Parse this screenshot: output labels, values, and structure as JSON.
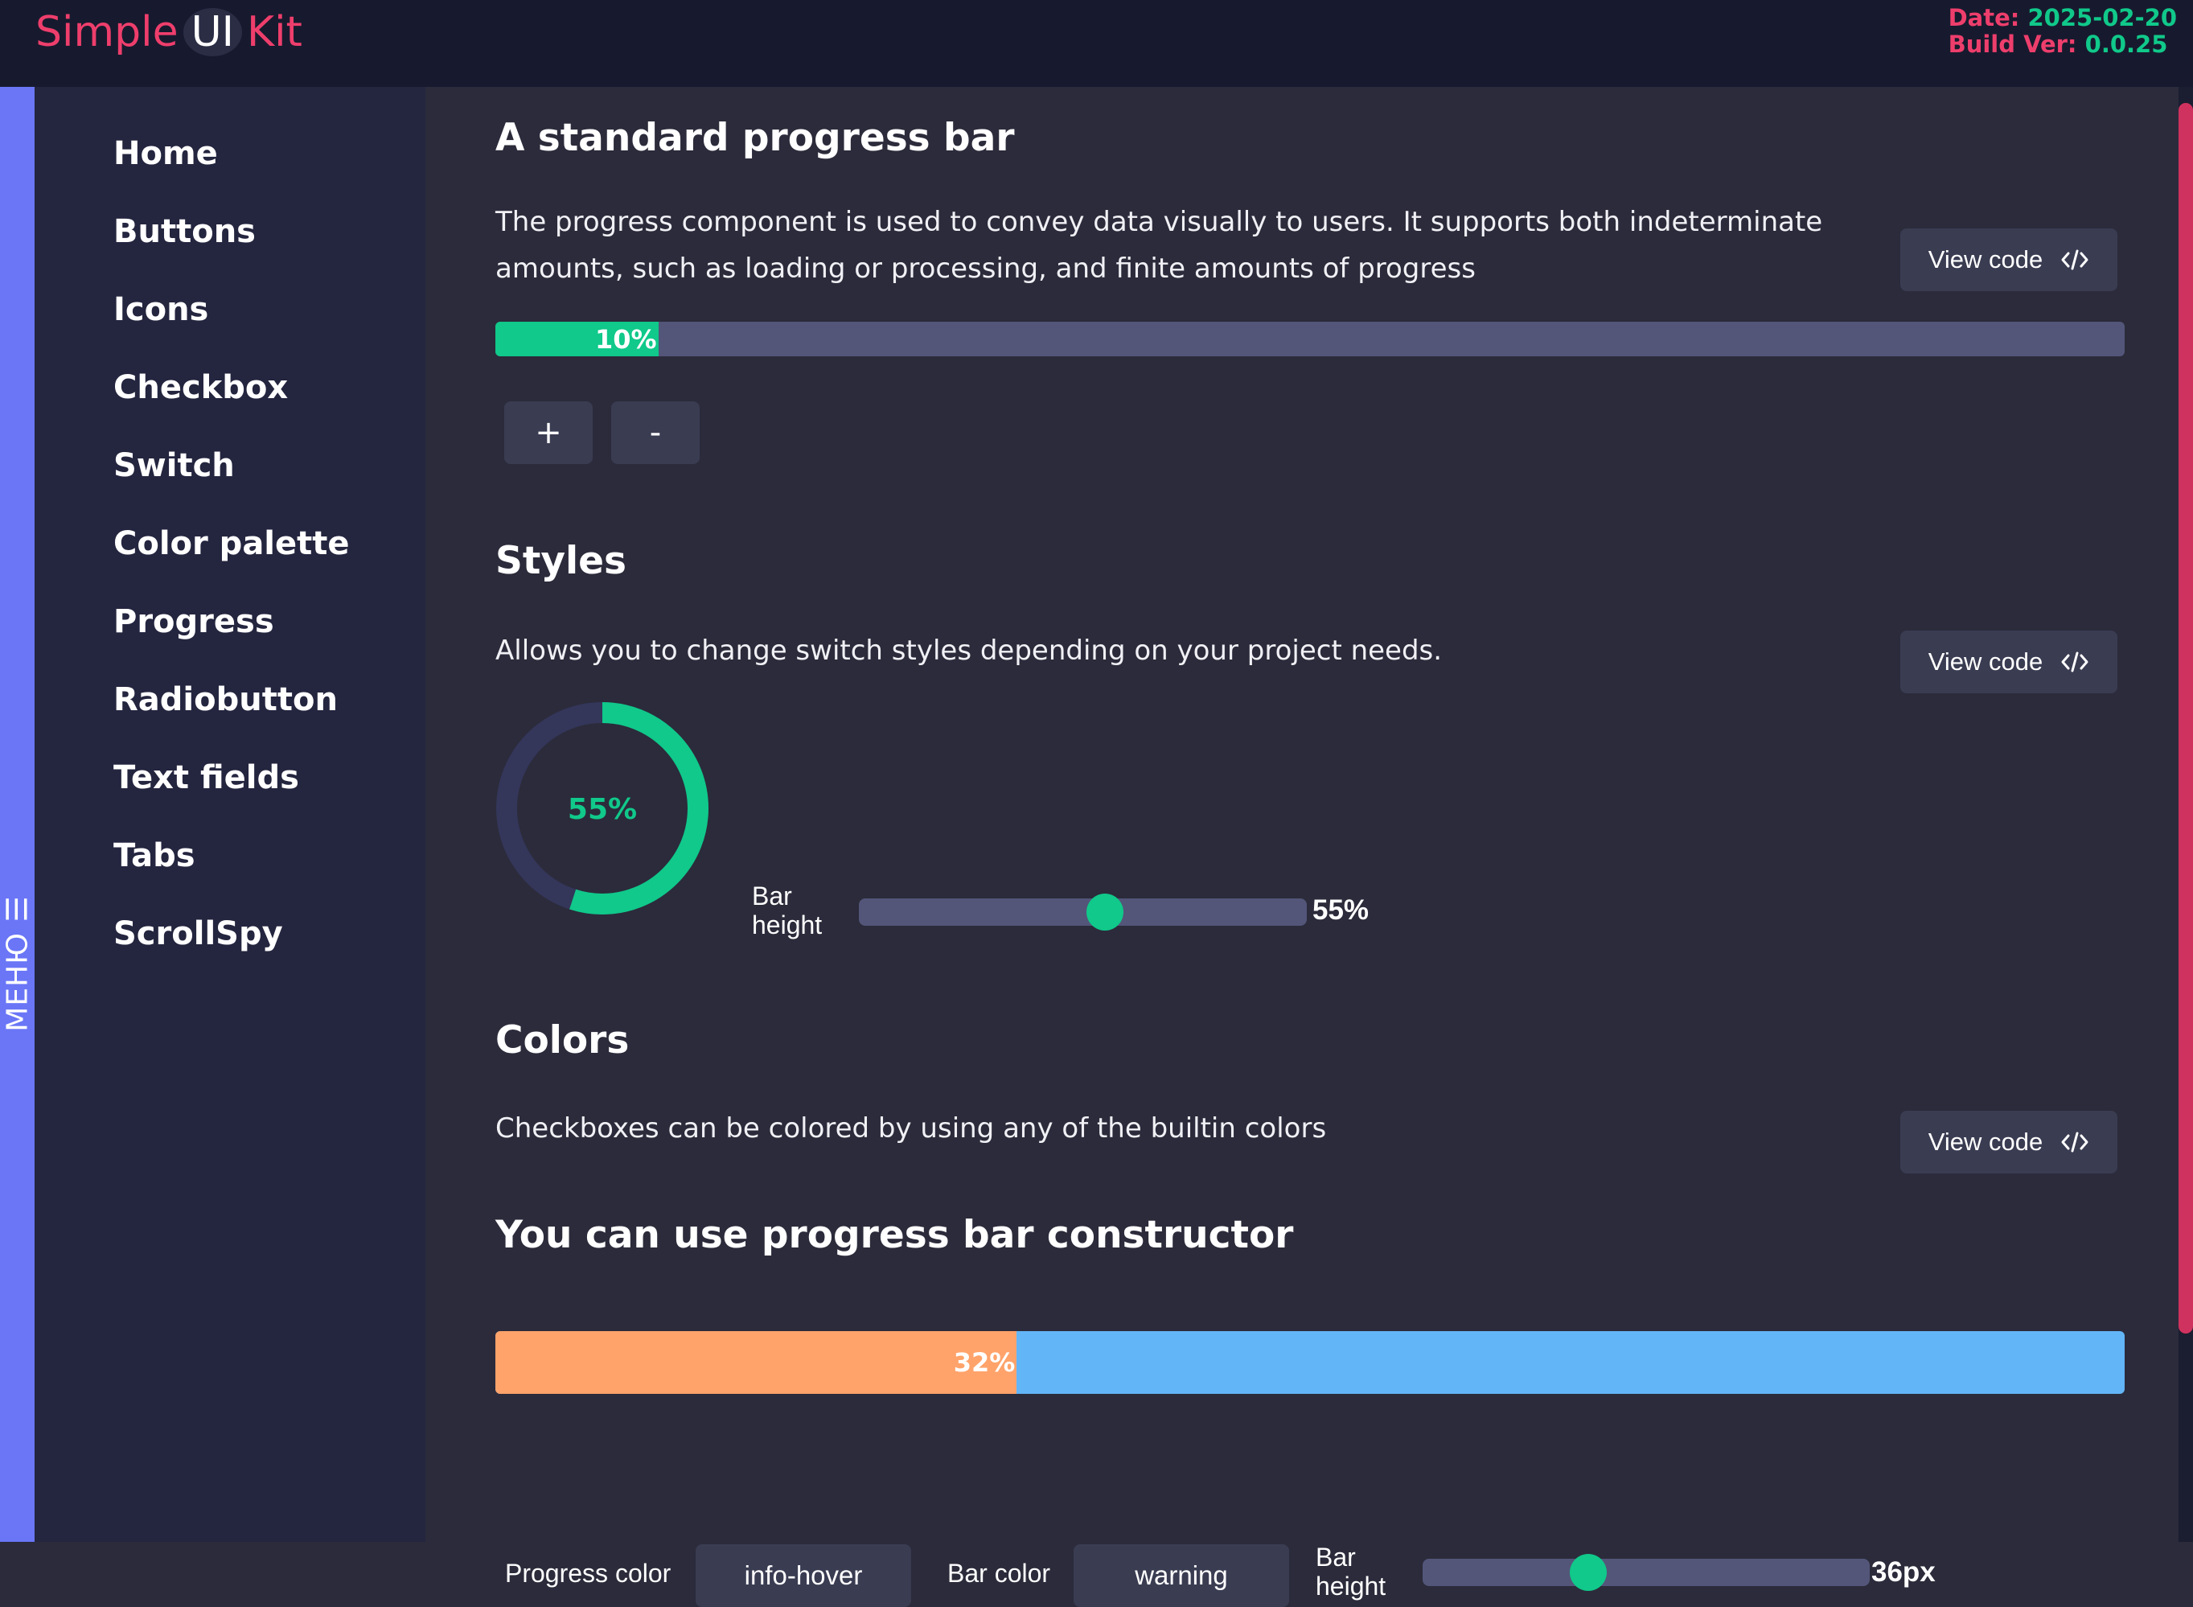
{
  "header": {
    "logo": {
      "part1": "Simple",
      "part2": "UI",
      "part3": "Kit"
    },
    "date_label": "Date:",
    "date_value": "2025-02-20",
    "build_label": "Build Ver:",
    "build_value": "0.0.25"
  },
  "menu_toggle": {
    "label": "МЕНЮ ☰"
  },
  "sidebar": {
    "items": [
      {
        "label": "Home"
      },
      {
        "label": "Buttons"
      },
      {
        "label": "Icons"
      },
      {
        "label": "Checkbox"
      },
      {
        "label": "Switch"
      },
      {
        "label": "Color palette"
      },
      {
        "label": "Progress"
      },
      {
        "label": "Radiobutton"
      },
      {
        "label": "Text fields"
      },
      {
        "label": "Tabs"
      },
      {
        "label": "ScrollSpy"
      }
    ]
  },
  "sections": {
    "standard": {
      "title": "A standard progress bar",
      "description": "The progress component is used to convey data visually to users. It supports both indeterminate amounts, such as loading or processing, and finite amounts of progress",
      "view_code": "View code",
      "progress_value": 10,
      "progress_label": "10%",
      "plus_label": "+",
      "minus_label": "-"
    },
    "styles": {
      "title": "Styles",
      "description": "Allows you to change switch styles depending on your project needs.",
      "view_code": "View code",
      "circle_value": 55,
      "circle_label": "55%",
      "slider_label": "Bar height",
      "slider_value": 55,
      "slider_value_label": "55%"
    },
    "colors": {
      "title": "Colors",
      "description": "Checkboxes can be colored by using any of the builtin colors",
      "view_code": "View code"
    },
    "constructor": {
      "title": "You can use progress bar constructor",
      "progress_value": 32,
      "progress_label": "32%",
      "progress_color_label": "Progress color",
      "progress_color_value": "info-hover",
      "bar_color_label": "Bar color",
      "bar_color_value": "warning",
      "bar_height_label": "Bar height",
      "bar_height_slider_fraction": 0.37,
      "bar_height_value_label": "36px"
    }
  },
  "colors": {
    "accent_green": "#10c98a",
    "accent_pink": "#ee3e6c",
    "progress_track": "#535679",
    "warning_orange": "#ffa36b",
    "info_blue": "#62b5f7",
    "menu_strip": "#6a76f6"
  },
  "icons": {
    "view_code_icon": "code-brackets-icon",
    "menu_icon": "hamburger-icon"
  }
}
